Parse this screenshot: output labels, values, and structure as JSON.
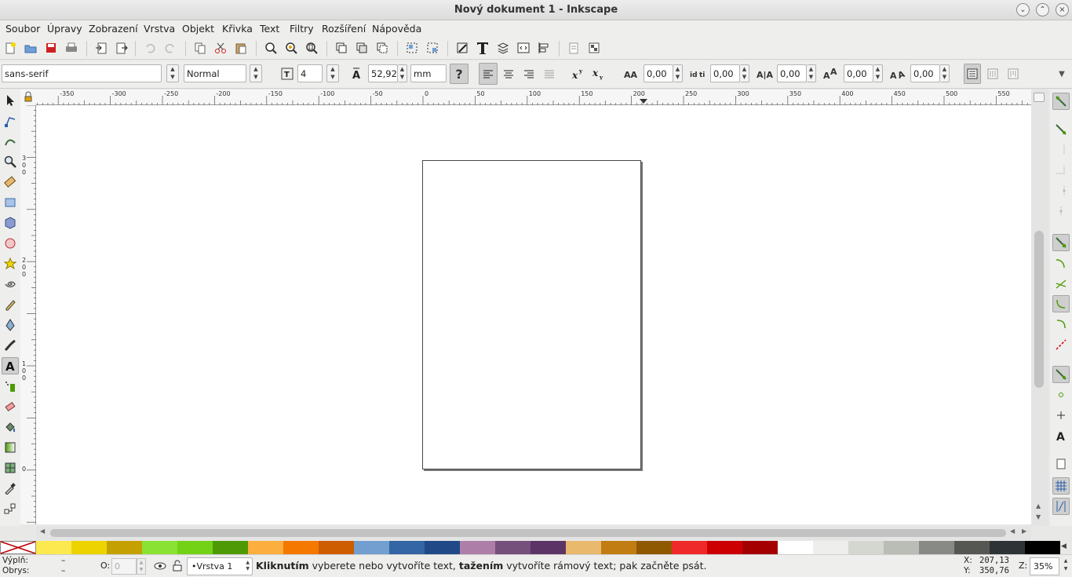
{
  "window": {
    "title": "Nový dokument 1 - Inkscape"
  },
  "menu": [
    "Soubor",
    "Úpravy",
    "Zobrazení",
    "Vrstva",
    "Objekt",
    "Křivka",
    "Text",
    "Filtry",
    "Rozšíření",
    "Nápověda"
  ],
  "text_toolbar": {
    "font_family": "sans-serif",
    "font_style": "Normal",
    "font_size": "4",
    "line_spacing": "52,92",
    "unit": "mm",
    "letter_spacing": "0,00",
    "word_spacing": "0,00",
    "kerning": "0,00",
    "vertical_shift": "0,00",
    "rotation": "0,00"
  },
  "rulers": {
    "horizontal_ticks": [
      "-350",
      "-300",
      "-250",
      "-200",
      "-150",
      "-100",
      "-50",
      "0",
      "50",
      "100",
      "150",
      "200",
      "250",
      "300",
      "350",
      "400",
      "450",
      "500",
      "550"
    ],
    "vertical_ticks": [
      "300",
      "200",
      "100",
      "0"
    ]
  },
  "palette": [
    "#fce94f",
    "#edd400",
    "#c4a000",
    "#8ae234",
    "#73d216",
    "#4e9a06",
    "#fcaf3e",
    "#f57900",
    "#ce5c00",
    "#729fcf",
    "#3465a4",
    "#204a87",
    "#ad7fa8",
    "#75507b",
    "#5c3566",
    "#e9b96e",
    "#c17d11",
    "#8f5902",
    "#ef2929",
    "#cc0000",
    "#a40000",
    "#ffffff",
    "#eeeeec",
    "#d3d7cf",
    "#babdb6",
    "#888a85",
    "#555753",
    "#2e3436",
    "#000000"
  ],
  "status": {
    "fill_label": "Výplň:",
    "stroke_label": "Obrys:",
    "fill_value": "–",
    "stroke_value": "–",
    "opacity_label": "O:",
    "opacity_value": "0",
    "layer": "•Vrstva 1",
    "message_b1": "Kliknutím",
    "message_t1": " vyberete nebo vytvoříte text, ",
    "message_b2": "tažením",
    "message_t2": " vytvoříte rámový text; pak začněte psát.",
    "x_label": "X:",
    "y_label": "Y:",
    "x_value": "207,13",
    "y_value": "350,76",
    "zoom_label": "Z:",
    "zoom_value": "35%"
  }
}
